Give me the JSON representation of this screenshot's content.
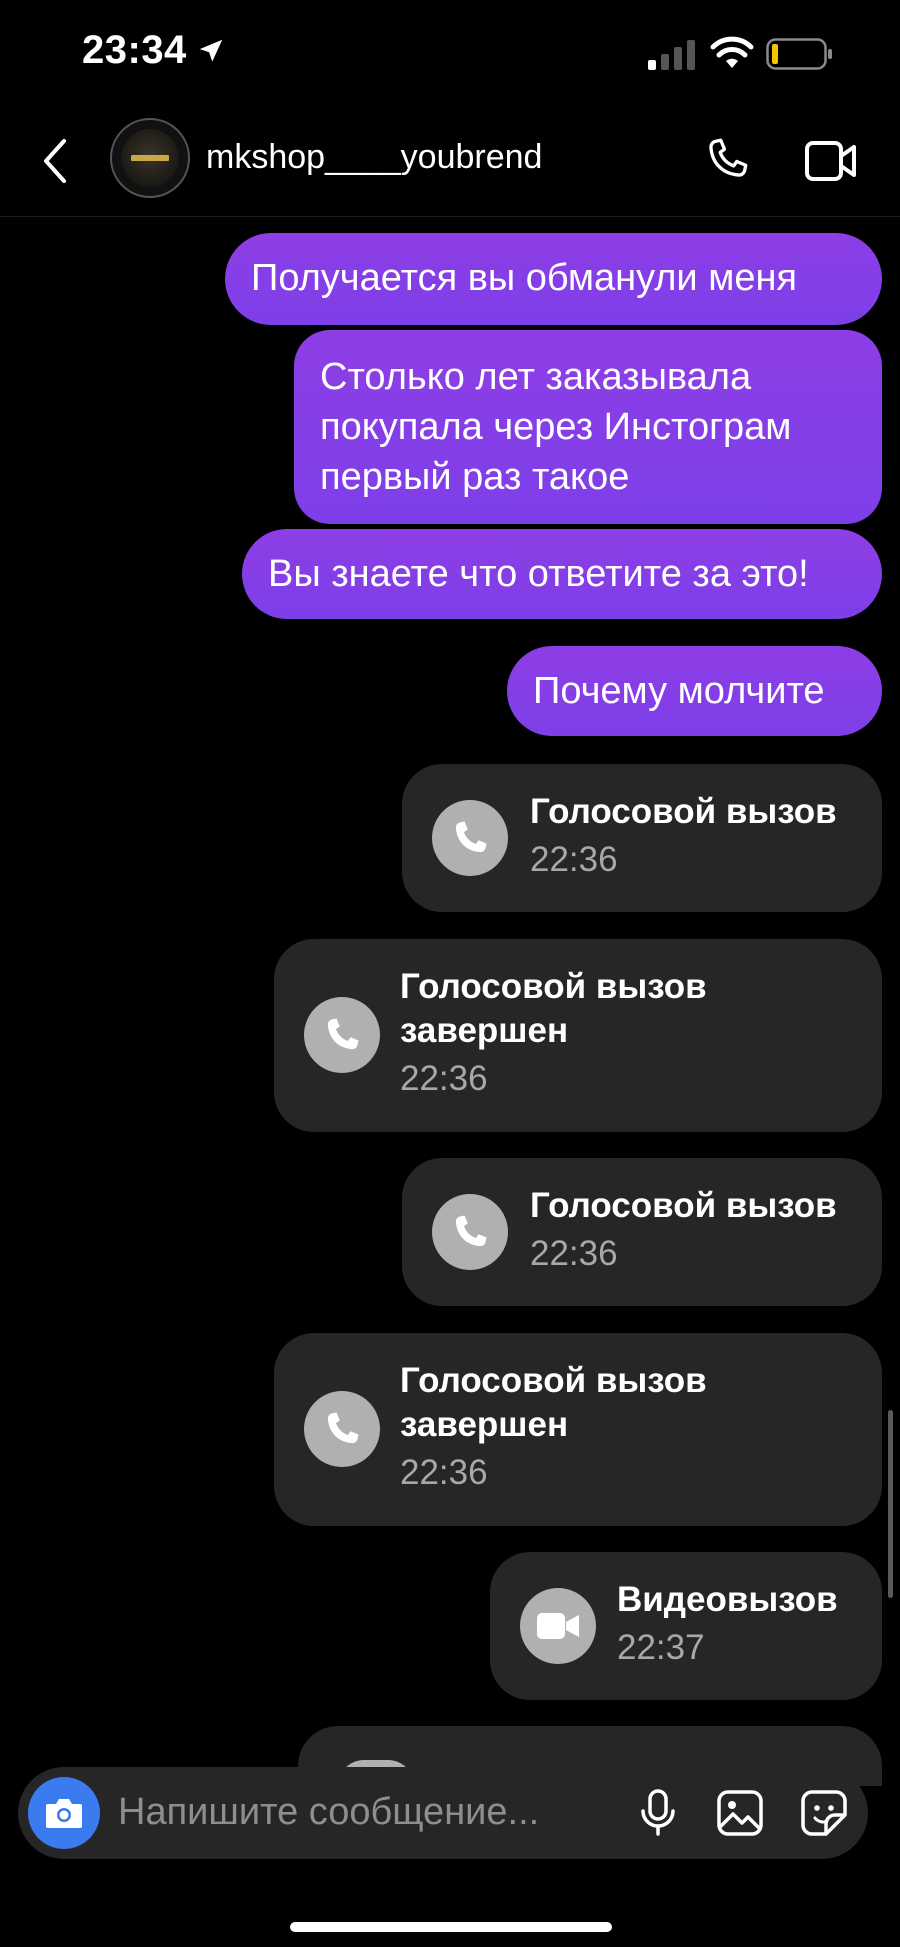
{
  "status_bar": {
    "time": "23:34"
  },
  "header": {
    "username": "mkshop____youbrend"
  },
  "messages": [
    {
      "text": "Получается вы обманули  меня"
    },
    {
      "text": "Столько лет заказывала покупала через Инстограм первый раз такое"
    },
    {
      "text": "Вы знаете что ответите за это!"
    },
    {
      "text": "Почему молчите"
    }
  ],
  "calls": [
    {
      "title": "Голосовой вызов",
      "time": "22:36",
      "icon": "phone-icon"
    },
    {
      "title": "Голосовой вызов завершен",
      "time": "22:36",
      "icon": "phone-outgoing-icon"
    },
    {
      "title": "Голосовой вызов",
      "time": "22:36",
      "icon": "phone-icon"
    },
    {
      "title": "Голосовой вызов завершен",
      "time": "22:36",
      "icon": "phone-outgoing-icon"
    },
    {
      "title": "Видеовызов",
      "time": "22:37",
      "icon": "video-camera-icon"
    }
  ],
  "composer": {
    "placeholder": "Напишите сообщение..."
  },
  "colors": {
    "bubble": "#8a3ee8",
    "call_card": "#262626",
    "camera_button": "#3a7bf0"
  }
}
